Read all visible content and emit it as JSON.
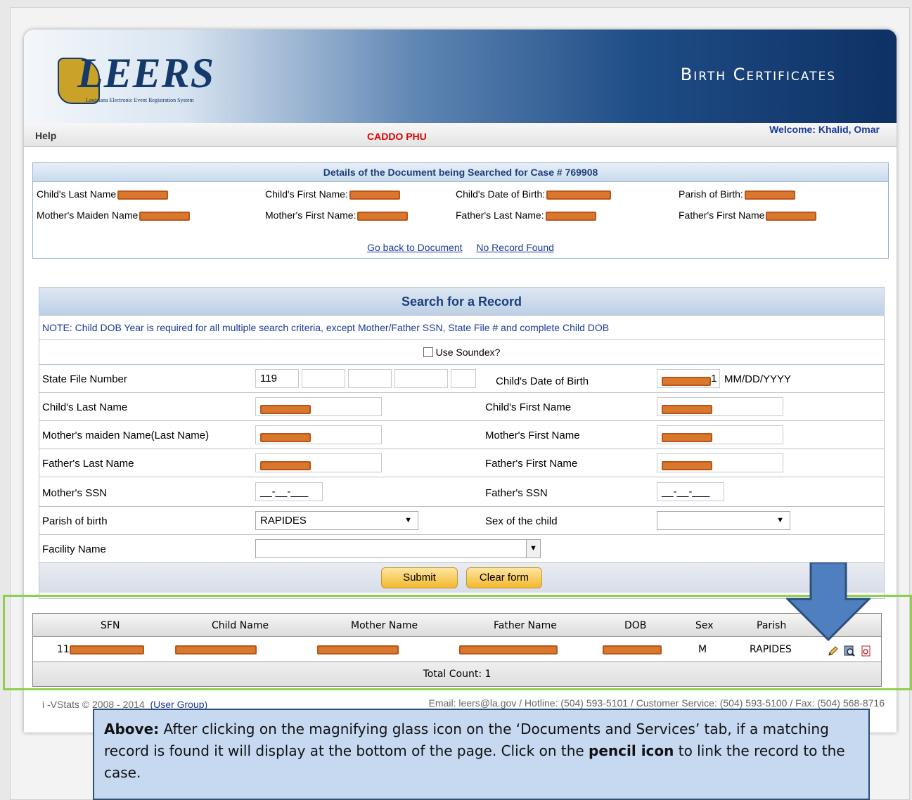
{
  "header": {
    "logo_text": "LEERS",
    "logo_subtitle": "Louisiana Electronic Event Registration System",
    "title": "Birth Certificates"
  },
  "topbar": {
    "help": "Help",
    "unit": "CADDO PHU",
    "welcome": "Welcome: Khalid, Omar"
  },
  "details": {
    "heading": "Details of the Document being Searched for Case # 769908",
    "fields": {
      "child_last": "Child's Last Name",
      "child_first": "Child's First Name:",
      "child_dob": "Child's Date of Birth:",
      "parish": "Parish of Birth:",
      "mother_maiden": "Mother's Maiden Name",
      "mother_first": "Mother's First Name:",
      "father_last": "Father's Last Name:",
      "father_first": "Father's First Name"
    },
    "link_back": "Go back to Document",
    "link_none": "No Record Found"
  },
  "search": {
    "title": "Search for a Record",
    "note": "NOTE: Child DOB Year is required for all multiple search criteria, except Mother/Father SSN, State File # and complete Child DOB",
    "soundex_label": "Use Soundex?",
    "labels": {
      "state_file": "State File Number",
      "child_dob": "Child's Date of Birth",
      "dob_format": "MM/DD/YYYY",
      "child_last": "Child's Last Name",
      "child_first": "Child's First Name",
      "mother_maiden": "Mother's maiden Name(Last Name)",
      "mother_first": "Mother's First Name",
      "father_last": "Father's Last Name",
      "father_first": "Father's First Name",
      "mother_ssn": "Mother's SSN",
      "father_ssn": "Father's SSN",
      "parish": "Parish of birth",
      "sex": "Sex of the child",
      "facility": "Facility Name"
    },
    "values": {
      "state_file_1": "119",
      "ssn_mask": "__-__-___",
      "parish": "RAPIDES",
      "sex": "",
      "facility": "",
      "dob_visible_tail": "1"
    },
    "submit": "Submit",
    "clear": "Clear form"
  },
  "results": {
    "columns": [
      "SFN",
      "Child Name",
      "Mother Name",
      "Father Name",
      "DOB",
      "Sex",
      "Parish"
    ],
    "row": {
      "sfn_prefix": "11",
      "sex": "M",
      "parish": "RAPIDES"
    },
    "total": "Total Count: 1"
  },
  "footer": {
    "left_prefix": "i -VStats © 2008 - 2014",
    "left_link": "(User Group)",
    "right": "Email: leers@la.gov / Hotline: (504) 593-5101 / Customer Service: (504) 593-5100 / Fax: (504) 568-8716"
  },
  "caption": {
    "lead": "Above:",
    "text1": " After clicking on the magnifying glass icon on the ‘Documents and Services’ tab, if a matching record is found it will display at the bottom of the page. Click on the ",
    "emph": "pencil icon",
    "text2": " to link the record to the case."
  },
  "colors": {
    "redaction": "#d9782d",
    "highlight_frame": "#8fce4f",
    "arrow": "#4f7fbf",
    "caption_bg": "#c6d9f0"
  }
}
